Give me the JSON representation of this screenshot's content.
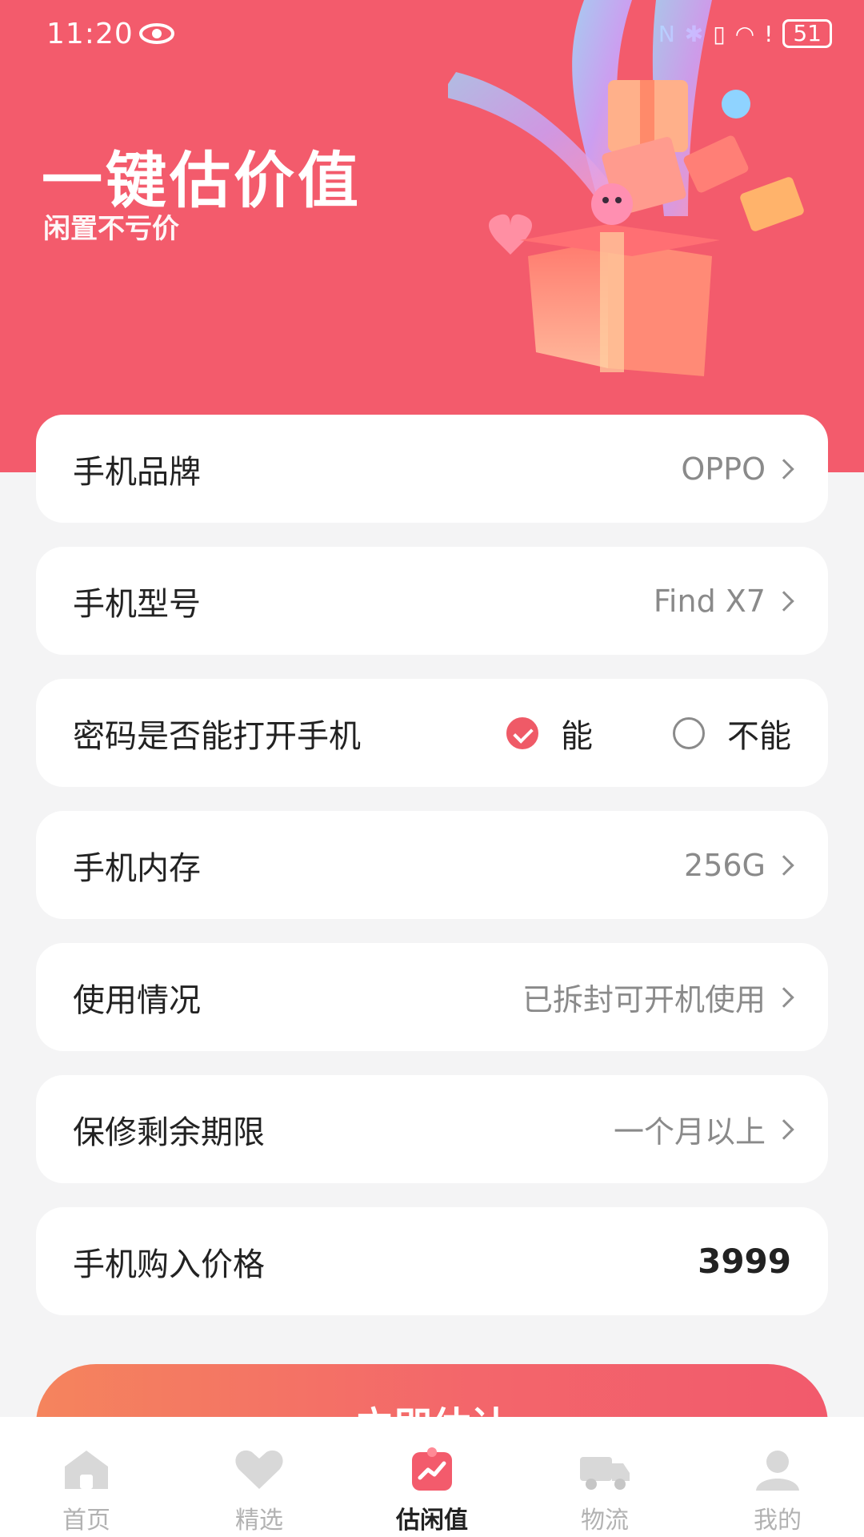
{
  "status_bar": {
    "time": "11:20",
    "battery": "51",
    "icons": [
      "eye-icon",
      "nfc-icon",
      "bluetooth-icon",
      "vibrate-icon",
      "wifi-icon",
      "alert-icon",
      "battery-icon"
    ]
  },
  "hero": {
    "title": "一键估价值",
    "subtitle": "闲置不亏价"
  },
  "form": {
    "brand": {
      "label": "手机品牌",
      "value": "OPPO"
    },
    "model": {
      "label": "手机型号",
      "value": "Find X7"
    },
    "password": {
      "label": "密码是否能打开手机",
      "options": [
        "能",
        "不能"
      ],
      "selected": "能"
    },
    "storage": {
      "label": "手机内存",
      "value": "256G"
    },
    "condition": {
      "label": "使用情况",
      "value": "已拆封可开机使用"
    },
    "warranty": {
      "label": "保修剩余期限",
      "value": "一个月以上"
    },
    "price": {
      "label": "手机购入价格",
      "value": "3999"
    }
  },
  "cta": {
    "label": "立即估计"
  },
  "tabbar": {
    "items": [
      {
        "label": "首页",
        "icon": "home-icon"
      },
      {
        "label": "精选",
        "icon": "heart-icon"
      },
      {
        "label": "估闲值",
        "icon": "estimate-icon",
        "active": true
      },
      {
        "label": "物流",
        "icon": "truck-icon"
      },
      {
        "label": "我的",
        "icon": "profile-icon"
      }
    ]
  },
  "colors": {
    "brand": "#f35b6c",
    "accent": "#ef5a67",
    "background": "#f4f4f5"
  }
}
